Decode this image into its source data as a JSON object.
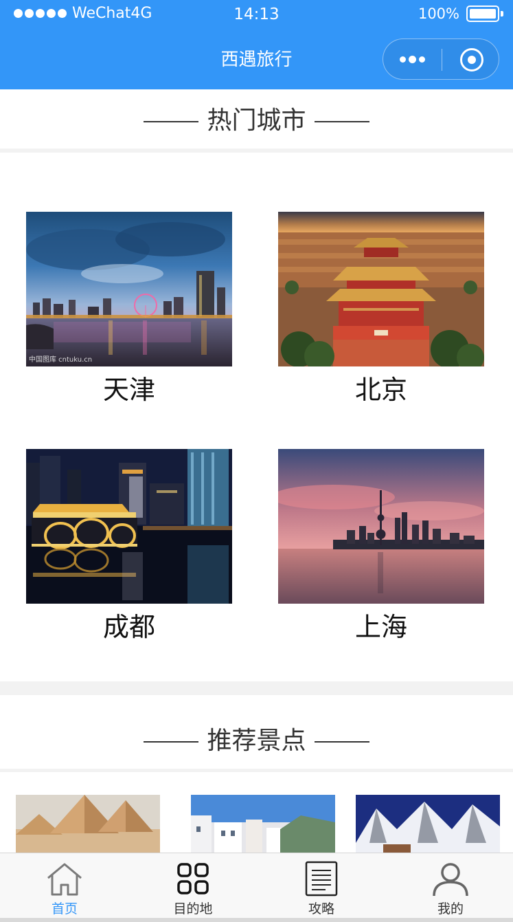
{
  "status": {
    "carrier": "WeChat4G",
    "time": "14:13",
    "battery": "100%"
  },
  "nav": {
    "title": "西遇旅行"
  },
  "hot_cities": {
    "title": "热门城市",
    "items": [
      {
        "name": "天津",
        "watermark": "中国图库 cntuku.cn"
      },
      {
        "name": "北京",
        "watermark": ""
      },
      {
        "name": "成都",
        "watermark": ""
      },
      {
        "name": "上海",
        "watermark": ""
      }
    ]
  },
  "recommend": {
    "title": "推荐景点"
  },
  "tabbar": {
    "items": [
      {
        "label": "首页",
        "icon": "home-icon"
      },
      {
        "label": "目的地",
        "icon": "grid-icon"
      },
      {
        "label": "攻略",
        "icon": "document-icon"
      },
      {
        "label": "我的",
        "icon": "user-icon"
      }
    ]
  },
  "colors": {
    "primary": "#3396f8",
    "tab_active": "#3396f8",
    "tab_inactive": "#333333"
  }
}
